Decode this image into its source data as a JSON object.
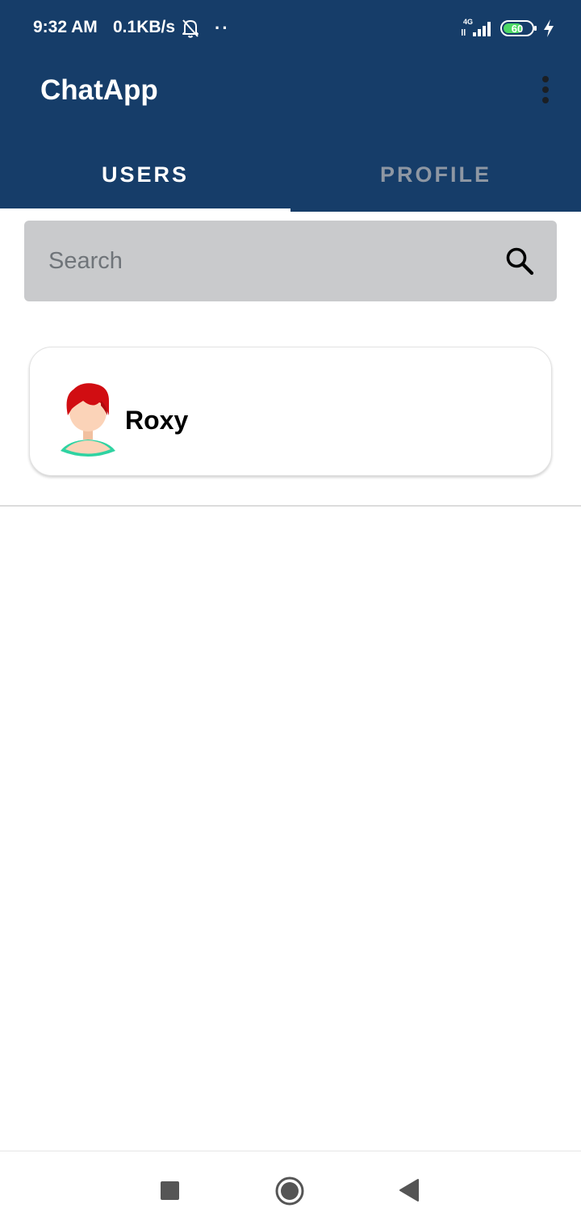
{
  "status_bar": {
    "time": "9:32 AM",
    "speed": "0.1KB/s",
    "dots": "··",
    "network": "4G",
    "battery": "60"
  },
  "app": {
    "title": "ChatApp"
  },
  "tabs": [
    {
      "label": "USERS",
      "selected": true
    },
    {
      "label": "PROFILE",
      "selected": false
    }
  ],
  "search": {
    "placeholder": "Search"
  },
  "users": [
    {
      "name": "Roxy"
    }
  ],
  "colors": {
    "appbar": "#163d69",
    "tab_inactive": "#8e97a3",
    "search_bg": "#c9cacc",
    "avatar_hair": "#d10d12",
    "avatar_shirt": "#2fd3a2"
  },
  "icons": {
    "bell": "bell-off-icon",
    "signal": "signal-icon",
    "battery": "battery-icon",
    "charge": "charging-icon",
    "menu": "more-vert-icon",
    "search": "search-icon",
    "recent": "recent-apps-icon",
    "home": "home-icon",
    "back": "back-icon"
  }
}
